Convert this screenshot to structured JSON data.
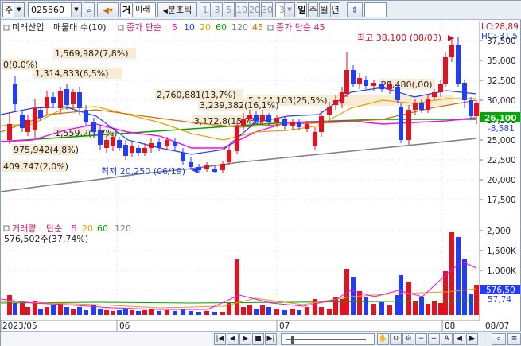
{
  "toolbar": {
    "market": "주",
    "code": "025560",
    "mode_btn": "거",
    "mode_label": "미래",
    "period_label": "분초틱",
    "minute_options": [
      "1",
      "3",
      "5",
      "10",
      "20",
      "30"
    ],
    "minute_selected": "3",
    "period_buttons": [
      "일",
      "주",
      "월",
      "년"
    ],
    "period_selected": "일"
  },
  "legend": {
    "stock_name": "미래산업",
    "price_label": "매물대 수(10)",
    "ma_label": "종가 단순",
    "ma_periods": [
      "5",
      "10",
      "20",
      "60",
      "120",
      "45"
    ],
    "ma_colors": [
      "#ff00ff",
      "#1f3cff",
      "#e6a000",
      "#00a000",
      "#808080",
      "#d07000"
    ],
    "ma2_label": "종가 단순 45",
    "volume_label": "거래량",
    "vol_ma_label": "단순",
    "vol_ma_periods": [
      "5",
      "20",
      "60",
      "120"
    ]
  },
  "annotations": {
    "high": "최고 38,100 (08/03)",
    "low": "최저 20,250 (06/19)",
    "lc": "LC:28,89",
    "hc": "HC:-31,5",
    "current_price": "26,100",
    "change": "-8,581",
    "current_volume": "576,50",
    "volume_ma": "57,74",
    "volume_info": "576,502주(37,74%)"
  },
  "volume_profile": [
    {
      "label": "0(0,0%)",
      "pct": 0.0
    },
    {
      "label": "1,569,982(7,8%)",
      "pct": 7.8
    },
    {
      "label": "1,314,833(6,5%)",
      "pct": 6.5
    },
    {
      "label": "5,144,103(25,5%)",
      "pct": 25.5
    },
    {
      "label": "29,480(,00)",
      "pct": 0.0
    },
    {
      "label": "2,760,881(13,7%)",
      "pct": 13.7
    },
    {
      "label": "3,239,382(16,1%)",
      "pct": 16.1
    },
    {
      "label": "3,172,8(15,7%)",
      "pct": 15.7
    },
    {
      "label": "1,559,2(7,7%)",
      "pct": 7.7
    },
    {
      "label": "975,942(4,8%)",
      "pct": 4.8
    },
    {
      "label": "409,747(2,0%)",
      "pct": 2.0
    }
  ],
  "price_axis": [
    "37,500",
    "35,000",
    "32,500",
    "30,000",
    "27,500",
    "25,000",
    "22,500",
    "20,000",
    "17,500"
  ],
  "volume_axis": [
    "2,000",
    "1,500K",
    "1,000K",
    "500K"
  ],
  "date_labels": [
    "2023/05",
    "06",
    "07",
    "08",
    "08/07"
  ]
}
